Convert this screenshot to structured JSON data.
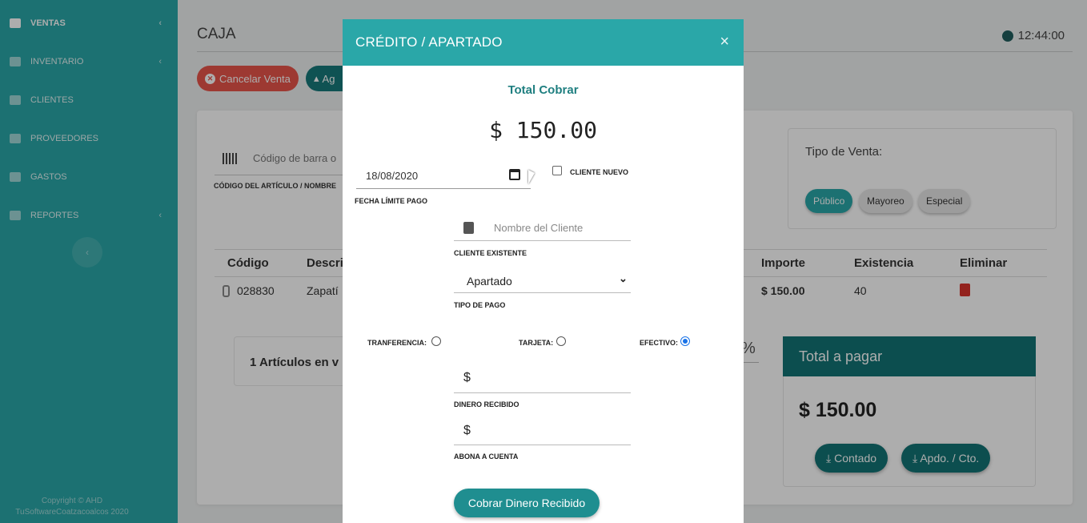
{
  "sidebar": {
    "items": [
      {
        "label": "VENTAS",
        "icon": "cart-icon"
      },
      {
        "label": "INVENTARIO",
        "icon": "box-icon"
      },
      {
        "label": "CLIENTES",
        "icon": "users-icon"
      },
      {
        "label": "PROVEEDORES",
        "icon": "truck-icon"
      },
      {
        "label": "GASTOS",
        "icon": "receipt-icon"
      },
      {
        "label": "REPORTES",
        "icon": "chart-icon"
      }
    ],
    "footer_line1": "Copyright © AHD",
    "footer_line2": "TuSoftwareCoatzacoalcos 2020"
  },
  "header": {
    "title": "CAJA",
    "time": "12:44:00"
  },
  "toolbar": {
    "cancel_label": "Cancelar Venta",
    "add_label": "Ag"
  },
  "search": {
    "placeholder": "Código de barra o",
    "label": "CÓDIGO DEL ARTÍCULO / NOMBRE"
  },
  "tipo_venta": {
    "title": "Tipo de Venta:",
    "options": [
      "Público",
      "Mayoreo",
      "Especial"
    ],
    "selected": "Público"
  },
  "table": {
    "headers": {
      "codigo": "Código",
      "descripcion": "Descri",
      "importe": "Importe",
      "existencia": "Existencia",
      "eliminar": "Eliminar"
    },
    "rows": [
      {
        "codigo": "028830",
        "descripcion": "Zapatí",
        "importe": "$ 150.00",
        "existencia": "40"
      }
    ]
  },
  "articulos": "1 Artículos en v",
  "percent_symbol": "%",
  "total": {
    "header": "Total a pagar",
    "amount": "$ 150.00",
    "btn_contado": "Contado",
    "btn_apartado": "Apdo. / Cto."
  },
  "modal": {
    "title": "CRÉDITO / APARTADO",
    "close": "×",
    "total_label": "Total Cobrar",
    "total_amount": "$ 150.00",
    "date_value": "18/08/2020",
    "date_label": "FECHA LÍMITE PAGO",
    "cliente_nuevo": "CLIENTE NUEVO",
    "cliente_placeholder": "Nombre del Cliente",
    "cliente_label": "CLIENTE EXISTENTE",
    "tipo_pago_value": "Apartado",
    "tipo_pago_label": "TIPO DE PAGO",
    "radio_transfer": "TRANFERENCIA:",
    "radio_tarjeta": "TARJETA:",
    "radio_efectivo": "EFECTIVO:",
    "radio_selected": "EFECTIVO:",
    "dinero_symbol": "$",
    "dinero_label": "DINERO RECIBIDO",
    "abona_symbol": "$",
    "abona_label": "ABONA A CUENTA",
    "cta_label": "Cobrar Dinero Recibido"
  },
  "colors": {
    "brand": "#2aa7a8",
    "dark_teal": "#137475",
    "danger": "#e8554a"
  }
}
